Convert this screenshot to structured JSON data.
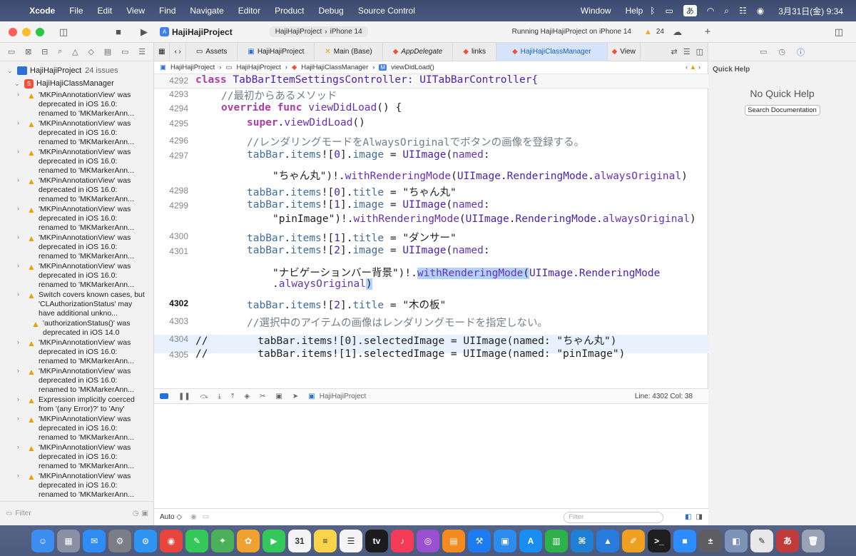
{
  "menubar": {
    "app": "Xcode",
    "items": [
      "File",
      "Edit",
      "View",
      "Find",
      "Navigate",
      "Editor",
      "Product",
      "Debug",
      "Source Control",
      "Window",
      "Help"
    ],
    "input_method": "あ",
    "datetime": "3月31日(金)  9:34"
  },
  "toolbar": {
    "project_title": "HajiHajiProject",
    "scheme": "HajiHajiProject",
    "device": "iPhone 14",
    "run_status": "Running HajiHajiProject on iPhone 14",
    "warning_count": "24"
  },
  "navigator": {
    "project_label": "HajiHajiProject",
    "issue_count": "24 issues",
    "group_label": "HajiHajiClassManager",
    "issues": [
      {
        "text": "'MKPinAnnotationView' was deprecated in iOS 16.0: renamed to 'MKMarkerAnn...",
        "expand": true
      },
      {
        "text": "'MKPinAnnotationView' was deprecated in iOS 16.0: renamed to 'MKMarkerAnn...",
        "expand": true
      },
      {
        "text": "'MKPinAnnotationView' was deprecated in iOS 16.0: renamed to 'MKMarkerAnn...",
        "expand": true
      },
      {
        "text": "'MKPinAnnotationView' was deprecated in iOS 16.0: renamed to 'MKMarkerAnn...",
        "expand": true
      },
      {
        "text": "'MKPinAnnotationView' was deprecated in iOS 16.0: renamed to 'MKMarkerAnn...",
        "expand": true
      },
      {
        "text": "'MKPinAnnotationView' was deprecated in iOS 16.0: renamed to 'MKMarkerAnn...",
        "expand": true
      },
      {
        "text": "'MKPinAnnotationView' was deprecated in iOS 16.0: renamed to 'MKMarkerAnn...",
        "expand": true
      },
      {
        "text": "Switch covers known cases, but 'CLAuthorizationStatus' may have additional unkno...",
        "expand": true
      },
      {
        "text": "'authorizationStatus()' was deprecated in iOS 14.0",
        "expand": false
      },
      {
        "text": "'MKPinAnnotationView' was deprecated in iOS 16.0: renamed to 'MKMarkerAnn...",
        "expand": true
      },
      {
        "text": "'MKPinAnnotationView' was deprecated in iOS 16.0: renamed to 'MKMarkerAnn...",
        "expand": true
      },
      {
        "text": "Expression implicitly coerced from '(any Error)?' to 'Any'",
        "expand": true
      },
      {
        "text": "'MKPinAnnotationView' was deprecated in iOS 16.0: renamed to 'MKMarkerAnn...",
        "expand": true
      },
      {
        "text": "'MKPinAnnotationView' was deprecated in iOS 16.0: renamed to 'MKMarkerAnn...",
        "expand": true
      },
      {
        "text": "'MKPinAnnotationView' was deprecated in iOS 16.0: renamed to 'MKMarkerAnn...",
        "expand": true
      }
    ],
    "filter_placeholder": "Filter"
  },
  "tabs": [
    {
      "label": "Assets",
      "active": false
    },
    {
      "label": "HajiHajiProject",
      "active": false
    },
    {
      "label": "Main (Base)",
      "active": false
    },
    {
      "label": "AppDelegate",
      "active": false
    },
    {
      "label": "links",
      "active": false
    },
    {
      "label": "HajiHajiClassManager",
      "active": true
    },
    {
      "label": "View",
      "active": false
    }
  ],
  "jumpbar": [
    "HajiHajiProject",
    "HajiHajiProject",
    "HajiHajiClassManager",
    "viewDidLoad()"
  ],
  "code": {
    "line_numbers": [
      "4292",
      "4293",
      "4294",
      "4295",
      "4296",
      "4297",
      "4298",
      "4299",
      "4300",
      "4301",
      "4302",
      "4303",
      "4304",
      "4305"
    ],
    "sticky_header": "class TabBarItemSettingsController: UITabBarController{",
    "comment_1": "//最初からあるメソッド",
    "override_kw": "override",
    "func_kw": "func",
    "viewDidLoad_fn": "viewDidLoad",
    "super_kw": "super",
    "comment_2": "//レンダリングモードをAlwaysOriginalでボタンの画像を登録する。",
    "comment_3": "//選択中のアイテムの画像はレンダリングモードを指定しない。",
    "str_chanmaru": "\"ちゃん丸\"",
    "str_pin": "\"pinImage\"",
    "str_dancer": "\"ダンサー\"",
    "str_navbg": "\"ナビゲーションバー背景\"",
    "str_board": "\"木の板\"",
    "commented_1": "//        tabBar.items![0].selectedImage = UIImage(named: \"ちゃん丸\")",
    "commented_2": "//        tabBar.items![1].selectedImage = UIImage(named: \"pinImage\")"
  },
  "debugbar": {
    "target": "HajiHajiProject",
    "position": "Line: 4302  Col: 38"
  },
  "console": {
    "mode": "Auto ◇",
    "filter_placeholder": "Filter"
  },
  "inspector": {
    "title": "Quick Help",
    "empty": "No Quick Help",
    "button": "Search Documentation"
  },
  "dock": {
    "apps": [
      {
        "name": "Finder",
        "glyph": "☺",
        "color": "#3b8ef0"
      },
      {
        "name": "Launchpad",
        "glyph": "▦",
        "color": "#8a8fa3"
      },
      {
        "name": "Mail",
        "glyph": "✉",
        "color": "#2f8cf5"
      },
      {
        "name": "System Settings",
        "glyph": "⚙",
        "color": "#7d7d85"
      },
      {
        "name": "Safari",
        "glyph": "⊙",
        "color": "#2f93f2"
      },
      {
        "name": "Chrome",
        "glyph": "◉",
        "color": "#e8453c"
      },
      {
        "name": "Messages",
        "glyph": "✎",
        "color": "#35c759"
      },
      {
        "name": "Maps",
        "glyph": "⌖",
        "color": "#4cb05a"
      },
      {
        "name": "Photos",
        "glyph": "✿",
        "color": "#f0a230"
      },
      {
        "name": "FaceTime",
        "glyph": "▶",
        "color": "#34c759"
      },
      {
        "name": "Calendar",
        "glyph": "31",
        "color": "#f4f4f4"
      },
      {
        "name": "Notes",
        "glyph": "≡",
        "color": "#f7d44a"
      },
      {
        "name": "Reminders",
        "glyph": "☰",
        "color": "#f4f4f4"
      },
      {
        "name": "TV",
        "glyph": "tv",
        "color": "#1c1c1e"
      },
      {
        "name": "Music",
        "glyph": "♪",
        "color": "#f53b57"
      },
      {
        "name": "Podcasts",
        "glyph": "◎",
        "color": "#9b4fd1"
      },
      {
        "name": "Books",
        "glyph": "▤",
        "color": "#f58a1f"
      },
      {
        "name": "Xcode",
        "glyph": "⚒",
        "color": "#1c7cf0"
      },
      {
        "name": "Simulator",
        "glyph": "▣",
        "color": "#2d8cf0"
      },
      {
        "name": "App Store",
        "glyph": "A",
        "color": "#1a8df2"
      },
      {
        "name": "Numbers",
        "glyph": "▥",
        "color": "#2fb14a"
      },
      {
        "name": "VS Code",
        "glyph": "⌘",
        "color": "#1f7fd4"
      },
      {
        "name": "Keynote",
        "glyph": "▲",
        "color": "#2a7bde"
      },
      {
        "name": "Pages",
        "glyph": "✐",
        "color": "#f0a020"
      },
      {
        "name": "Terminal",
        "glyph": ">_",
        "color": "#1e1e1e"
      },
      {
        "name": "Zoom",
        "glyph": "■",
        "color": "#2d8cff"
      },
      {
        "name": "Calculator",
        "glyph": "±",
        "color": "#5d5d62"
      },
      {
        "name": "Preview",
        "glyph": "◧",
        "color": "#7f93b8"
      },
      {
        "name": "TextEdit",
        "glyph": "✎",
        "color": "#e8e8e8"
      },
      {
        "name": "Dictionary",
        "glyph": "あ",
        "color": "#c23b3b"
      },
      {
        "name": "Trash",
        "glyph": "🗑",
        "color": "#9aa3b5"
      }
    ]
  },
  "colors": {
    "keyword": "#ad3da4",
    "type": "#4b21b0",
    "comment": "#707f8c",
    "selection": "#b2d3ff",
    "current_line": "#e8f2ff",
    "active_tab": "#d6e4fb"
  }
}
